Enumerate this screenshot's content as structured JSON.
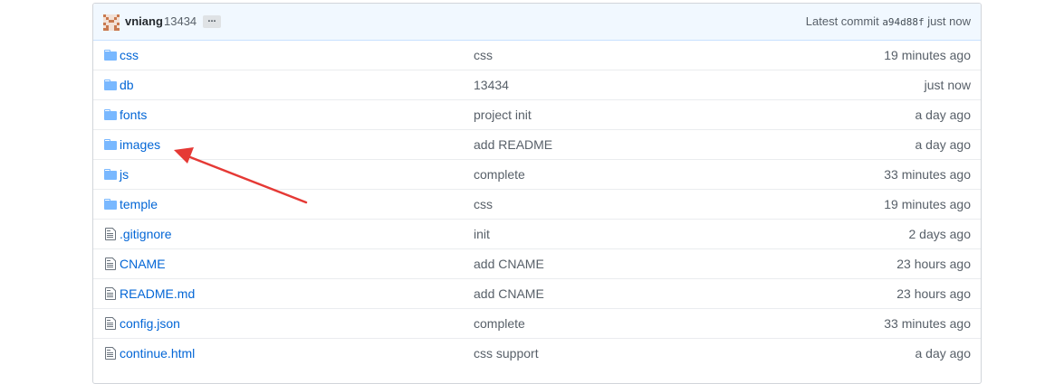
{
  "commit": {
    "author": "vniang",
    "message": "13434",
    "ellipsis": "...",
    "latest_label": "Latest commit",
    "sha": "a94d88f",
    "age": "just now"
  },
  "files": [
    {
      "type": "dir",
      "icon": "folder-icon",
      "name": "css",
      "message": "css",
      "age": "19 minutes ago"
    },
    {
      "type": "dir",
      "icon": "folder-icon",
      "name": "db",
      "message": "13434",
      "age": "just now"
    },
    {
      "type": "dir",
      "icon": "folder-icon",
      "name": "fonts",
      "message": "project init",
      "age": "a day ago"
    },
    {
      "type": "dir",
      "icon": "folder-icon",
      "name": "images",
      "message": "add README",
      "age": "a day ago"
    },
    {
      "type": "dir",
      "icon": "folder-icon",
      "name": "js",
      "message": "complete",
      "age": "33 minutes ago"
    },
    {
      "type": "dir",
      "icon": "folder-icon",
      "name": "temple",
      "message": "css",
      "age": "19 minutes ago"
    },
    {
      "type": "file",
      "icon": "file-icon",
      "name": ".gitignore",
      "message": "init",
      "age": "2 days ago"
    },
    {
      "type": "file",
      "icon": "file-icon",
      "name": "CNAME",
      "message": "add CNAME",
      "age": "23 hours ago"
    },
    {
      "type": "file",
      "icon": "file-icon",
      "name": "README.md",
      "message": "add CNAME",
      "age": "23 hours ago"
    },
    {
      "type": "file",
      "icon": "file-icon",
      "name": "config.json",
      "message": "complete",
      "age": "33 minutes ago"
    },
    {
      "type": "file",
      "icon": "file-icon",
      "name": "continue.html",
      "message": "css support",
      "age": "a day ago"
    }
  ],
  "colors": {
    "link": "#0366d6",
    "muted": "#586069",
    "commit_bar_bg": "#f1f8ff",
    "folder_icon": "#79b8ff",
    "annotation_arrow": "#e53935"
  }
}
